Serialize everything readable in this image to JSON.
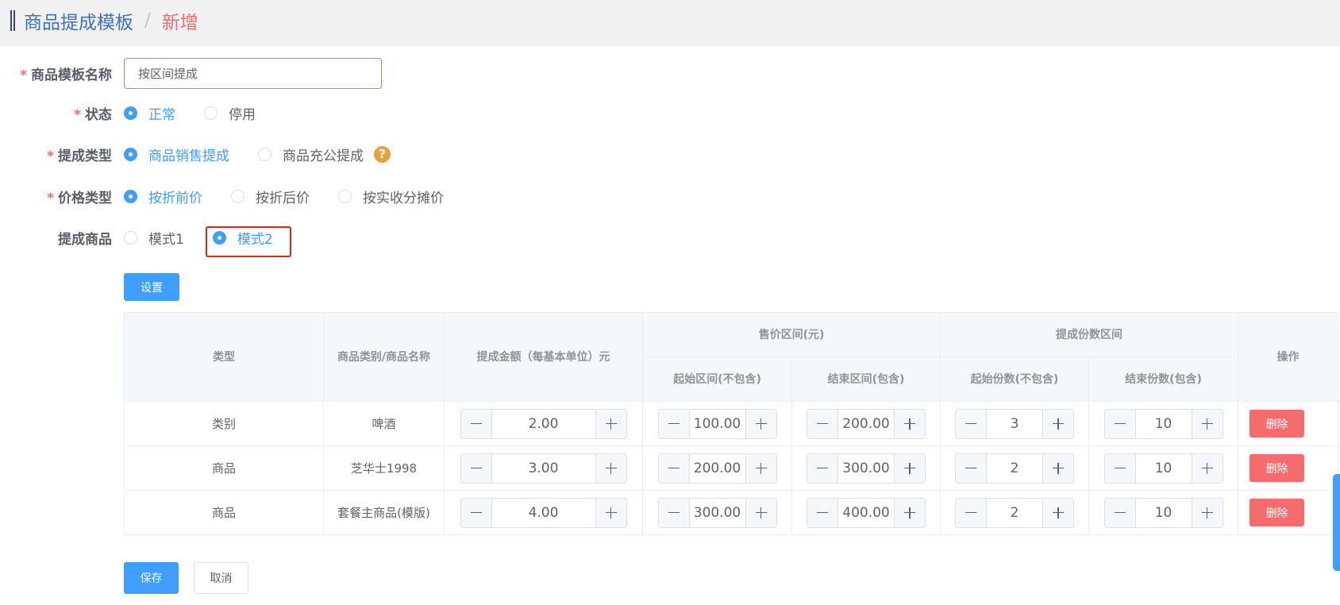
{
  "breadcrumb": {
    "title": "商品提成模板",
    "separator": "/",
    "current": "新增"
  },
  "form": {
    "required_mark": "*",
    "template_name": {
      "label": "商品模板名称",
      "value": "按区间提成"
    },
    "status": {
      "label": "状态",
      "options": [
        {
          "label": "正常",
          "checked": true
        },
        {
          "label": "停用",
          "checked": false
        }
      ]
    },
    "commission_type": {
      "label": "提成类型",
      "options": [
        {
          "label": "商品销售提成",
          "checked": true
        },
        {
          "label": "商品充公提成",
          "checked": false
        }
      ],
      "help_icon": "question-circle-icon"
    },
    "price_type": {
      "label": "价格类型",
      "options": [
        {
          "label": "按折前价",
          "checked": true
        },
        {
          "label": "按折后价",
          "checked": false
        },
        {
          "label": "按实收分摊价",
          "checked": false
        }
      ]
    },
    "commission_goods": {
      "label": "提成商品",
      "options": [
        {
          "label": "模式1",
          "checked": false
        },
        {
          "label": "模式2",
          "checked": true
        }
      ]
    },
    "settings_button": "设置"
  },
  "table": {
    "headers": {
      "type": "类型",
      "category": "商品类别/商品名称",
      "amount": "提成金额（每基本单位）元",
      "price_range": "售价区间(元)",
      "price_start": "起始区间(不包含)",
      "price_end": "结束区间(包含)",
      "count_range": "提成份数区间",
      "count_start": "起始份数(不包含)",
      "count_end": "结束份数(包含)",
      "action": "操作"
    },
    "rows": [
      {
        "type": "类别",
        "name": "啤酒",
        "amount": "2.00",
        "price_start": "100.00",
        "price_end": "200.00",
        "count_start": "3",
        "count_end": "10",
        "delete": "删除"
      },
      {
        "type": "商品",
        "name": "芝华士1998",
        "amount": "3.00",
        "price_start": "200.00",
        "price_end": "300.00",
        "count_start": "2",
        "count_end": "10",
        "delete": "删除"
      },
      {
        "type": "商品",
        "name": "套餐主商品(模版)",
        "amount": "4.00",
        "price_start": "300.00",
        "price_end": "400.00",
        "count_start": "2",
        "count_end": "10",
        "delete": "删除"
      }
    ]
  },
  "footer": {
    "save": "保存",
    "cancel": "取消"
  },
  "icons": {
    "stepper_decrease": "minus-icon",
    "stepper_increase": "plus-icon",
    "help": "question-circle-icon"
  },
  "colors": {
    "primary": "#409eff",
    "danger": "#f56c6c",
    "warning": "#e6a23c",
    "input_border_valid": "#67c23a",
    "highlight_box": "#e8231a",
    "breadcrumb_title": "#3d72b8"
  }
}
